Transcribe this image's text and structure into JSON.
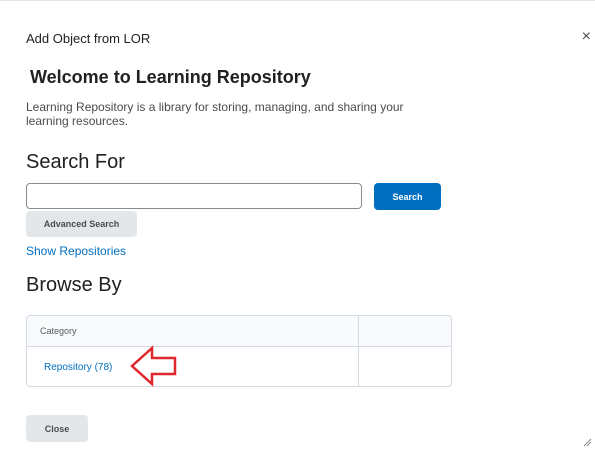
{
  "dialog": {
    "title": "Add Object from LOR",
    "close_icon": "×"
  },
  "welcome": {
    "heading": "Welcome to Learning Repository",
    "description": "Learning Repository is a library for storing, managing, and sharing your learning resources."
  },
  "search": {
    "heading": "Search For",
    "input_value": "",
    "button_label": "Search",
    "advanced_label": "Advanced Search",
    "show_repositories": "Show Repositories"
  },
  "browse": {
    "heading": "Browse By",
    "column_header": "Category",
    "rows": [
      {
        "label": "Repository",
        "count": "(78)"
      }
    ]
  },
  "footer": {
    "close_label": "Close"
  },
  "colors": {
    "primary": "#006fbf",
    "annotation_arrow": "#e0262d",
    "secondary_button": "#e4e7ea"
  },
  "icons": {
    "close": "close-icon",
    "annotation": "arrow-left-icon",
    "resize": "resize-grip-icon"
  }
}
